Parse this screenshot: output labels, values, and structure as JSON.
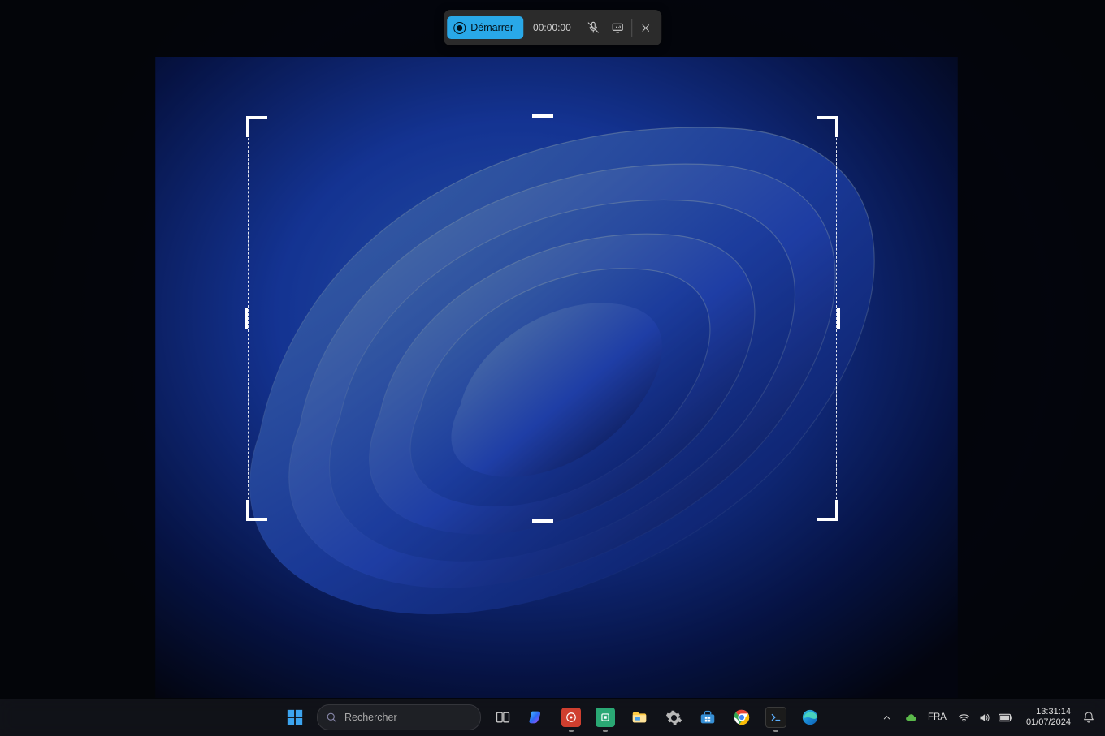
{
  "recorder": {
    "start_label": "Démarrer",
    "timer": "00:00:00",
    "mic_icon": "microphone-muted-icon",
    "speaker_icon": "system-audio-icon",
    "close_icon": "close-icon"
  },
  "taskbar": {
    "search_placeholder": "Rechercher",
    "apps": [
      {
        "name": "start",
        "label": "Start"
      },
      {
        "name": "search",
        "label": "Search"
      },
      {
        "name": "task-view",
        "label": "Task View"
      },
      {
        "name": "copilot",
        "label": "Copilot"
      },
      {
        "name": "powertoys",
        "label": "PowerToys"
      },
      {
        "name": "registry-editor",
        "label": "Registry Editor"
      },
      {
        "name": "file-explorer",
        "label": "File Explorer"
      },
      {
        "name": "settings",
        "label": "Settings"
      },
      {
        "name": "microsoft-store",
        "label": "Microsoft Store"
      },
      {
        "name": "chrome",
        "label": "Google Chrome"
      },
      {
        "name": "terminal",
        "label": "Terminal"
      },
      {
        "name": "edge",
        "label": "Microsoft Edge"
      }
    ],
    "tray": {
      "overflow_icon": "chevron-up-icon",
      "onedrive_icon": "onedrive-icon",
      "language": "FRA",
      "wifi_icon": "wifi-icon",
      "volume_icon": "volume-icon",
      "battery_icon": "battery-icon",
      "notifications_icon": "bell-icon"
    },
    "clock": {
      "time": "13:31:14",
      "date": "01/07/2024"
    }
  }
}
